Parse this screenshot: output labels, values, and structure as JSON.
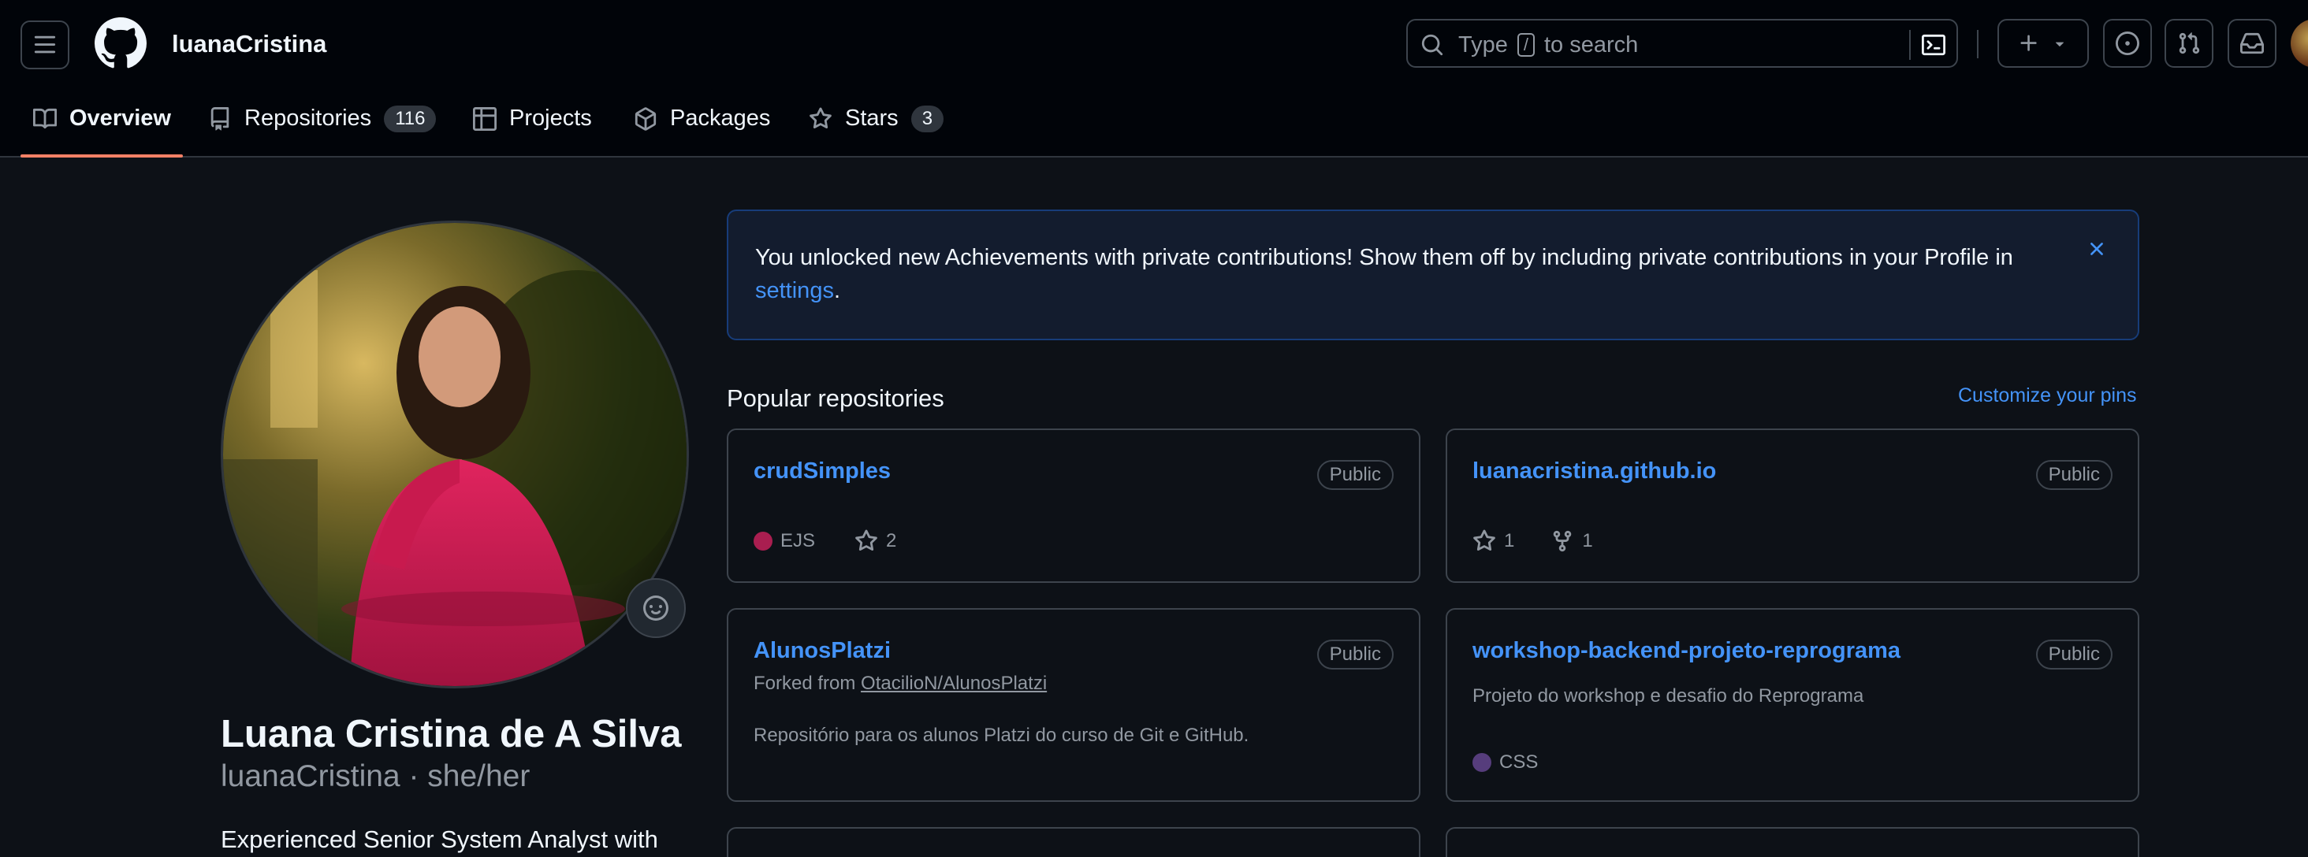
{
  "header": {
    "username": "luanaCristina",
    "search": {
      "prefix": "Type",
      "key": "/",
      "suffix": "to search"
    }
  },
  "tabs": [
    {
      "label": "Overview",
      "active": true
    },
    {
      "label": "Repositories",
      "count": "116"
    },
    {
      "label": "Projects"
    },
    {
      "label": "Packages"
    },
    {
      "label": "Stars",
      "count": "3"
    }
  ],
  "profile": {
    "full_name": "Luana Cristina de A Silva",
    "login_pronouns": "luanaCristina · she/her",
    "bio": "Experienced Senior System Analyst with"
  },
  "flash": {
    "text": "You unlocked new Achievements with private contributions! Show them off by including private contributions in your Profile in",
    "link": "settings",
    "end": "."
  },
  "popular": {
    "title": "Popular repositories",
    "customize": "Customize your pins"
  },
  "repos": [
    {
      "name": "crudSimples",
      "visibility": "Public",
      "language": "EJS",
      "lang_color": "#a91e50",
      "stars": "2"
    },
    {
      "name": "luanacristina.github.io",
      "visibility": "Public",
      "stars": "1",
      "forks": "1"
    },
    {
      "name": "AlunosPlatzi",
      "visibility": "Public",
      "forked_prefix": "Forked from",
      "forked_from": "OtacilioN/AlunosPlatzi",
      "description": "Repositório para os alunos Platzi do curso de Git e GitHub."
    },
    {
      "name": "workshop-backend-projeto-reprograma",
      "visibility": "Public",
      "description": "Projeto do workshop e desafio do Reprograma",
      "language": "CSS",
      "lang_color": "#563d7c"
    }
  ],
  "colors": {
    "accent": "#4493f8",
    "underline": "#f78166",
    "bg": "#0d1117",
    "header_bg": "#010409"
  }
}
